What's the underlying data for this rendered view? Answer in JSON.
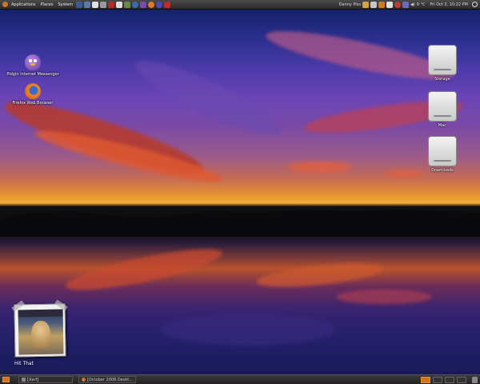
{
  "top_panel": {
    "menus": [
      "Applications",
      "Places",
      "System"
    ],
    "user": "Danny Piss",
    "weather": "9 °C",
    "clock": "Fri Oct  3, 10:22 PM"
  },
  "desktop": {
    "left_icons": [
      {
        "label": "Pidgin Internet Messenger",
        "icon": "pidgin-icon"
      },
      {
        "label": "Firefox Web Browser",
        "icon": "firefox-icon"
      }
    ],
    "right_icons": [
      {
        "label": "Storage",
        "icon": "drive-icon"
      },
      {
        "label": "Mac",
        "icon": "drive-icon"
      },
      {
        "label": "Downloads",
        "icon": "drive-icon"
      }
    ],
    "photo_caption": "Hit That"
  },
  "bottom_panel": {
    "tasks": [
      "[Xarf]",
      "[October 2008 Deskt..."
    ],
    "workspaces": 4,
    "active_workspace": 1
  },
  "colors": {
    "panel": "#2a2a2a",
    "accent": "#d0761a"
  }
}
